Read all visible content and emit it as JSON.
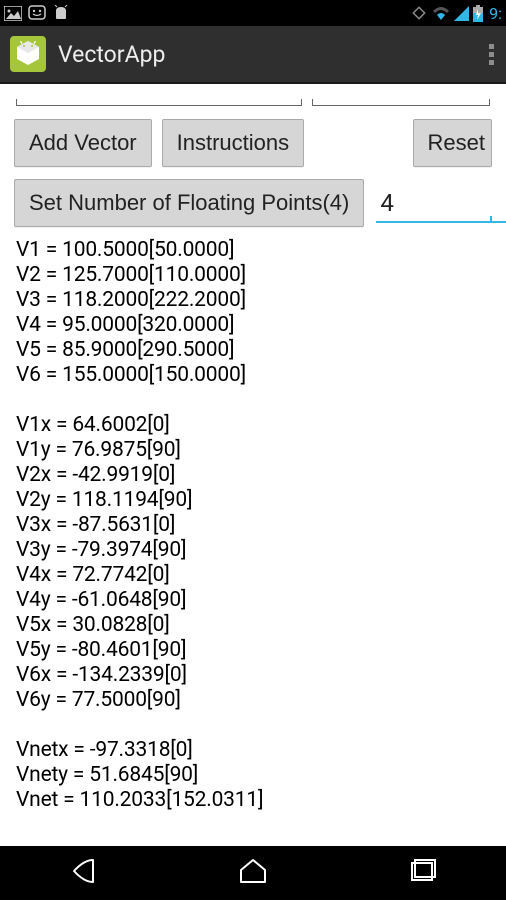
{
  "status": {
    "time": "9:"
  },
  "app": {
    "title": "VectorApp"
  },
  "buttons": {
    "add": "Add Vector",
    "instructions": "Instructions",
    "reset": "Reset",
    "setFloat": "Set Number of Floating Points(4)"
  },
  "floatInput": {
    "value": "4"
  },
  "vectors": [
    "V1 = 100.5000[50.0000]",
    "V2 = 125.7000[110.0000]",
    "V3 = 118.2000[222.2000]",
    "V4 = 95.0000[320.0000]",
    "V5 = 85.9000[290.5000]",
    "V6 = 155.0000[150.0000]"
  ],
  "components": [
    "V1x = 64.6002[0]",
    "V1y = 76.9875[90]",
    "V2x = -42.9919[0]",
    "V2y = 118.1194[90]",
    "V3x = -87.5631[0]",
    "V3y = -79.3974[90]",
    "V4x = 72.7742[0]",
    "V4y = -61.0648[90]",
    "V5x = 30.0828[0]",
    "V5y = -80.4601[90]",
    "V6x = -134.2339[0]",
    "V6y = 77.5000[90]"
  ],
  "net": [
    "Vnetx = -97.3318[0]",
    "Vnety = 51.6845[90]",
    "Vnet = 110.2033[152.0311]"
  ]
}
